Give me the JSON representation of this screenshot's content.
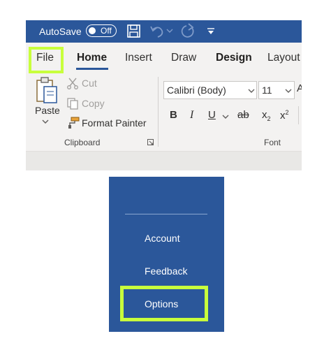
{
  "titlebar": {
    "autosave_label": "AutoSave",
    "autosave_state": "Off"
  },
  "tabs": [
    {
      "label": "File"
    },
    {
      "label": "Home"
    },
    {
      "label": "Insert"
    },
    {
      "label": "Draw"
    },
    {
      "label": "Design"
    },
    {
      "label": "Layout"
    }
  ],
  "clipboard": {
    "paste_label": "Paste",
    "cut_label": "Cut",
    "copy_label": "Copy",
    "format_painter_label": "Format Painter",
    "group_label": "Clipboard"
  },
  "font": {
    "font_name": "Calibri (Body)",
    "font_size": "11",
    "group_label": "Font",
    "bold_label": "B",
    "italic_label": "I",
    "underline_label": "U",
    "strike_label": "ab",
    "subscript_label": "x",
    "sub_digit": "2",
    "superscript_label": "x",
    "sup_digit": "2"
  },
  "backstage": {
    "items": [
      {
        "label": "Account"
      },
      {
        "label": "Feedback"
      },
      {
        "label": "Options"
      }
    ]
  },
  "colors": {
    "brand": "#2b579a",
    "highlight": "#c8ff3c"
  }
}
